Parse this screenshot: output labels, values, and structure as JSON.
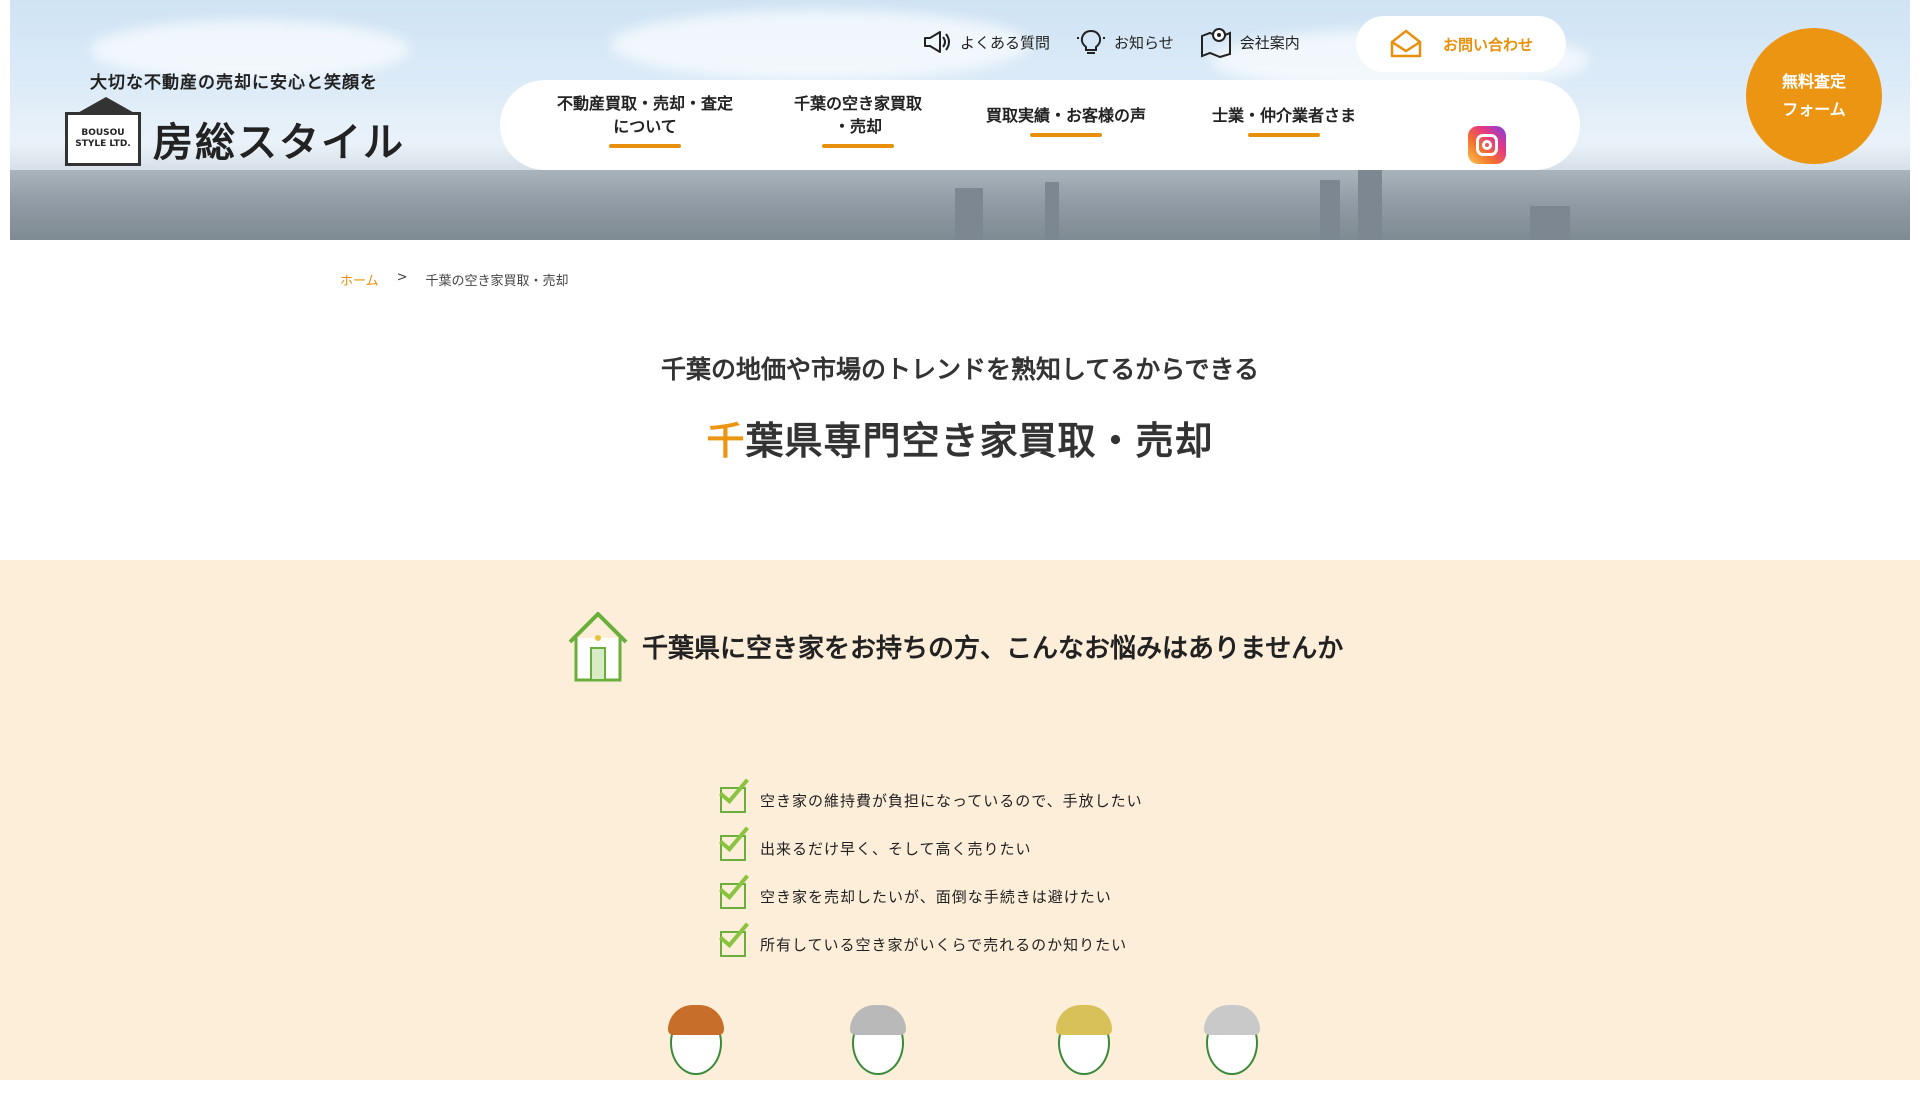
{
  "header": {
    "tagline": "大切な不動産の売却に安心と笑顔を",
    "logo_line1": "BOUSOU",
    "logo_line2": "STYLE LTD.",
    "logo_name": "房総スタイル",
    "topnav": [
      {
        "label": "よくある質問",
        "icon": "megaphone-icon"
      },
      {
        "label": "お知らせ",
        "icon": "lightbulb-icon"
      },
      {
        "label": "会社案内",
        "icon": "map-pin-icon"
      }
    ],
    "contact_label": "お問い合わせ",
    "contact_icon": "envelope-icon",
    "mainnav": [
      {
        "line1": "不動産買取・売却・査定",
        "line2": "について"
      },
      {
        "line1": "千葉の空き家買取",
        "line2": "・売却"
      },
      {
        "line1": "買取実績・お客様の声",
        "line2": ""
      },
      {
        "line1": "士業・仲介業者さま",
        "line2": ""
      }
    ],
    "instagram_icon": "instagram-icon",
    "free_btn_line1": "無料査定",
    "free_btn_line2": "フォーム"
  },
  "breadcrumb": {
    "home": "ホーム",
    "separator": ">",
    "current": "千葉の空き家買取・売却"
  },
  "title": {
    "sub": "千葉の地価や市場のトレンドを熟知してるからできる",
    "main_accent": "千",
    "main_rest": "葉県専門空き家買取・売却"
  },
  "section": {
    "title": "千葉県に空き家をお持ちの方、こんなお悩みはありませんか",
    "icon": "house-icon",
    "concerns": [
      "空き家の維持費が負担になっているので、手放したい",
      "出来るだけ早く、そして高く売りたい",
      "空き家を売却したいが、面倒な手続きは避けたい",
      "所有している空き家がいくらで売れるのか知りたい"
    ]
  },
  "colors": {
    "accent": "#ec9513",
    "section_bg": "#fdeed9",
    "check_green": "#8ac43f"
  }
}
